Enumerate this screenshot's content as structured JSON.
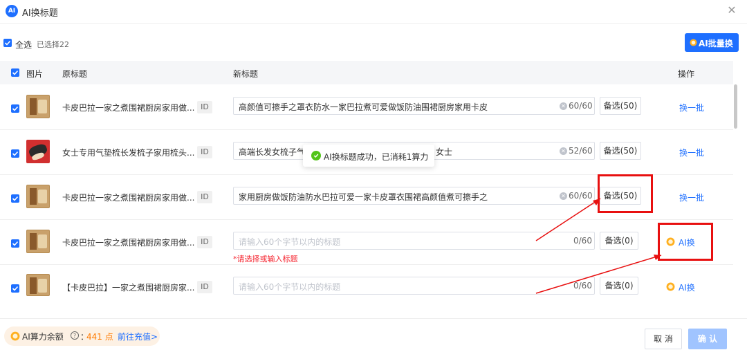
{
  "dialog": {
    "title": "AI换标题",
    "logo_text": "AI",
    "close_glyph": "✕"
  },
  "toolbar": {
    "select_all_label": "全选",
    "selected_count": "已选择22",
    "batch_button": "AI批量换"
  },
  "table": {
    "headers": {
      "image": "图片",
      "original_title": "原标题",
      "new_title": "新标题",
      "actions": "操作"
    },
    "rows": [
      {
        "thumb": "apron",
        "original_title": "卡皮巴拉一家之煮围裙厨房家用做...",
        "id_tag": "ID",
        "new_title": "高颜值可擦手之罩衣防水一家巴拉煮可爱做饭防油围裙厨房家用卡皮",
        "placeholder": "",
        "char_count": "60/60",
        "alt_label": "备选(50)",
        "action": "换一批"
      },
      {
        "thumb": "comb",
        "original_title": "女士专用气垫梳长发梳子家用梳头...",
        "id_tag": "ID",
        "new_title": "高端长发女梳子气",
        "new_title_tail": "女士",
        "placeholder": "",
        "char_count": "52/60",
        "alt_label": "备选(50)",
        "action": "换一批"
      },
      {
        "thumb": "apron",
        "original_title": "卡皮巴拉一家之煮围裙厨房家用做...",
        "id_tag": "ID",
        "new_title": "家用厨房做饭防油防水巴拉可爱一家卡皮罩衣围裙高颜值煮可擦手之",
        "placeholder": "",
        "char_count": "60/60",
        "alt_label": "备选(50)",
        "action": "换一批"
      },
      {
        "thumb": "apron",
        "original_title": "卡皮巴拉一家之煮围裙厨房家用做...",
        "id_tag": "ID",
        "new_title": "",
        "placeholder": "请输入60个字节以内的标题",
        "char_count": "0/60",
        "alt_label": "备选(0)",
        "action": "AI换",
        "error": "*请选择或输入标题"
      },
      {
        "thumb": "apron",
        "original_title": "【卡皮巴拉】一家之煮围裙厨房家...",
        "id_tag": "ID",
        "new_title": "",
        "placeholder": "请输入60个字节以内的标题",
        "char_count": "0/60",
        "alt_label": "备选(0)",
        "action": "AI换"
      }
    ]
  },
  "toast": {
    "message": "AI换标题成功，已消耗1算力"
  },
  "footer": {
    "balance_label": "AI算力余额",
    "help_glyph": "?",
    "balance_colon": "：",
    "balance_value": "441 点",
    "recharge_link": "前往充值>",
    "cancel_button": "取 消",
    "confirm_button": "确 认"
  },
  "colors": {
    "accent": "#1e6fff",
    "highlight": "#e81010",
    "orange": "#ff7a00",
    "error": "#f5222d",
    "success": "#52c41a"
  },
  "icons": {
    "logo": "ai-logo-icon",
    "coin": "coin-icon",
    "close": "close-icon",
    "check": "check-icon",
    "success": "success-icon"
  }
}
